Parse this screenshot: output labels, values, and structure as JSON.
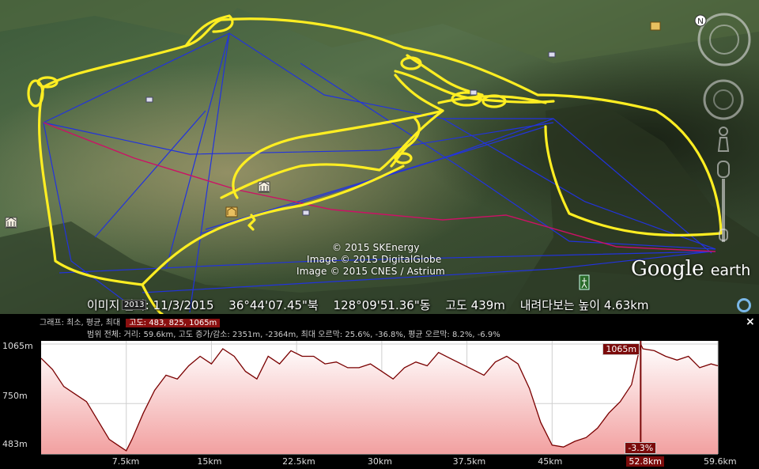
{
  "map": {
    "attribution": [
      "© 2015 SKEnergy",
      "Image © 2015 DigitalGlobe",
      "Image © 2015 CNES / Astrium"
    ],
    "logo": {
      "google": "Google",
      "earth": "earth"
    },
    "status": {
      "year": "2013",
      "date": "이미지 날짜: 11/3/2015",
      "lat": "36°44'07.45\"북",
      "lon": "128°09'51.36\"동",
      "elevation": "고도  439m",
      "eye_alt": "내려다보는 높이   4.63km"
    },
    "colors": {
      "track": "#ffee22",
      "route_blue": "#2233dd",
      "route_red": "#cc1166"
    },
    "icons": [
      "north-compass-icon",
      "look-joystick-icon",
      "move-joystick-icon",
      "street-view-pegman-icon",
      "zoom-slider-icon",
      "museum-icon",
      "temple-icon",
      "hiker-icon",
      "photo-icon"
    ]
  },
  "profile": {
    "row1_label": "그래프: 최소, 평균, 최대",
    "row1_highlight": "고도: 483, 825, 1065m",
    "row2": "범위 전체: 거리: 59.6km, 고도 증가/감소: 2351m, -2364m, 최대 오르막: 25.6%, -36.8%, 평균 오르막: 8.2%, -6.9%",
    "close": "×",
    "y_labels": [
      "1065m",
      "750m",
      "483m"
    ],
    "x_labels": [
      "7.5km",
      "15km",
      "22.5km",
      "30km",
      "37.5km",
      "45km",
      "52.8km",
      "59.6km"
    ],
    "marker_elev": "1065m",
    "marker_slope": "-3.3%",
    "colors": {
      "line": "#7a0000",
      "fill_top": "#ffffff",
      "fill_bottom": "#f2a0a0",
      "marker": "#7b0b0b"
    }
  },
  "chart_data": {
    "type": "area",
    "x": [
      0,
      1,
      2,
      3,
      4,
      5,
      6,
      7,
      7.5,
      8,
      9,
      10,
      11,
      12,
      13,
      14,
      15,
      16,
      17,
      18,
      19,
      20,
      21,
      22,
      23,
      24,
      25,
      26,
      27,
      28,
      29,
      30,
      31,
      32,
      33,
      34,
      35,
      36,
      37,
      38,
      39,
      40,
      41,
      42,
      43,
      44,
      45,
      46,
      47,
      48,
      49,
      50,
      51,
      52,
      52.8,
      53,
      54,
      55,
      56,
      57,
      58,
      59,
      59.6
    ],
    "values": [
      990,
      930,
      840,
      800,
      760,
      660,
      560,
      520,
      500,
      560,
      700,
      820,
      900,
      880,
      950,
      1000,
      960,
      1040,
      1000,
      920,
      880,
      1000,
      960,
      1030,
      1000,
      1000,
      960,
      970,
      940,
      940,
      960,
      920,
      880,
      940,
      970,
      950,
      1020,
      990,
      960,
      930,
      900,
      970,
      1000,
      960,
      830,
      650,
      530,
      520,
      550,
      570,
      620,
      700,
      760,
      850,
      1065,
      1040,
      1030,
      1000,
      980,
      1000,
      940,
      960,
      950
    ],
    "xlim": [
      0,
      59.6
    ],
    "ylim": [
      483,
      1065
    ],
    "yticks": [
      483,
      750,
      1065
    ],
    "xticks": [
      7.5,
      15,
      22.5,
      30,
      37.5,
      45,
      52.8,
      59.6
    ],
    "grid": true
  }
}
